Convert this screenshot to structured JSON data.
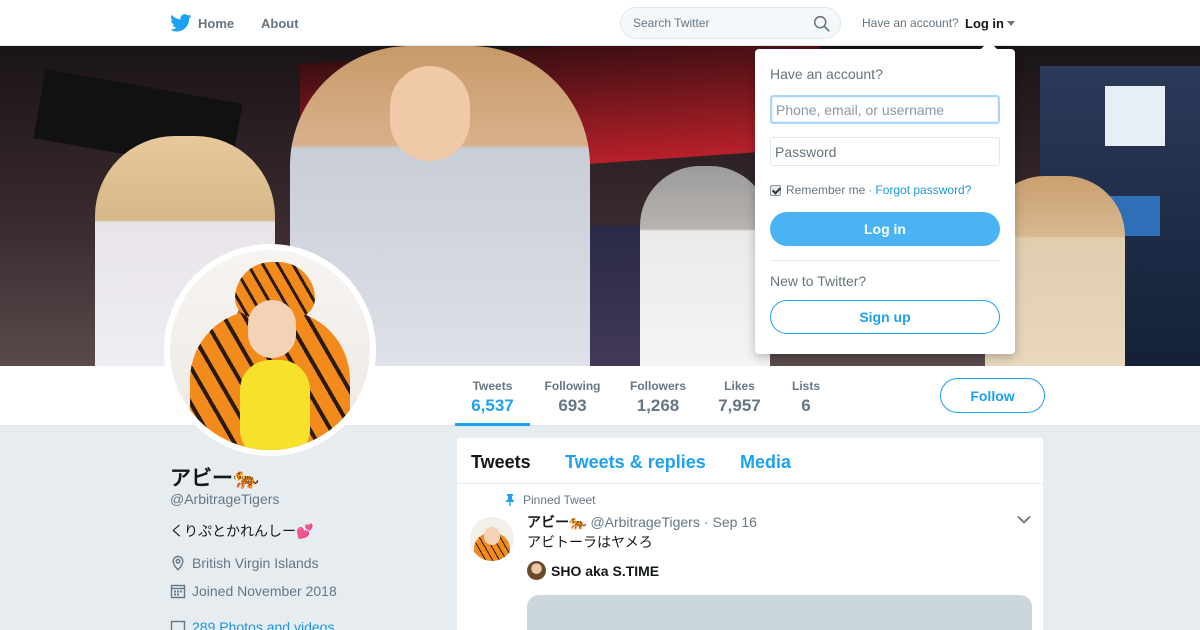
{
  "topbar": {
    "home_label": "Home",
    "about_label": "About",
    "search_placeholder": "Search Twitter",
    "have_account_text": "Have an account?",
    "login_label": "Log in"
  },
  "profile": {
    "display_name": "アビー🐅",
    "handle": "@ArbitrageTigers",
    "bio": "くりぷとかれんしー💕",
    "location": "British Virgin Islands",
    "joined": "Joined November 2018",
    "photos_link": "289 Photos and videos"
  },
  "stats": {
    "items": [
      {
        "label": "Tweets",
        "value": "6,537",
        "active": true
      },
      {
        "label": "Following",
        "value": "693"
      },
      {
        "label": "Followers",
        "value": "1,268"
      },
      {
        "label": "Likes",
        "value": "7,957"
      },
      {
        "label": "Lists",
        "value": "6"
      }
    ],
    "follow_label": "Follow"
  },
  "timeline": {
    "tabs": [
      {
        "label": "Tweets",
        "active": true
      },
      {
        "label": "Tweets & replies"
      },
      {
        "label": "Media"
      }
    ],
    "pinned_tweet": {
      "pinned_label": "Pinned Tweet",
      "name": "アビー🐅",
      "handle": "@ArbitrageTigers",
      "separator": "·",
      "time": "Sep 16",
      "text": "アビトーラはヤメろ",
      "mention_name": "SHO aka S.TIME"
    }
  },
  "login_dropdown": {
    "title": "Have an account?",
    "username_placeholder": "Phone, email, or username",
    "password_placeholder": "Password",
    "remember_label": "Remember me",
    "separator": "·",
    "forgot_label": "Forgot password?",
    "login_button": "Log in",
    "new_to_twitter": "New to Twitter?",
    "signup_button": "Sign up"
  },
  "colors": {
    "accent": "#1da1f2",
    "login_button_bg": "#4ab3f4",
    "page_bg": "#e6ecf0"
  },
  "icons": [
    "twitter-bird-icon",
    "search-icon",
    "caret-down-icon",
    "location-icon",
    "calendar-icon",
    "photo-icon",
    "pin-icon",
    "chevron-down-icon",
    "checkbox-checked"
  ]
}
